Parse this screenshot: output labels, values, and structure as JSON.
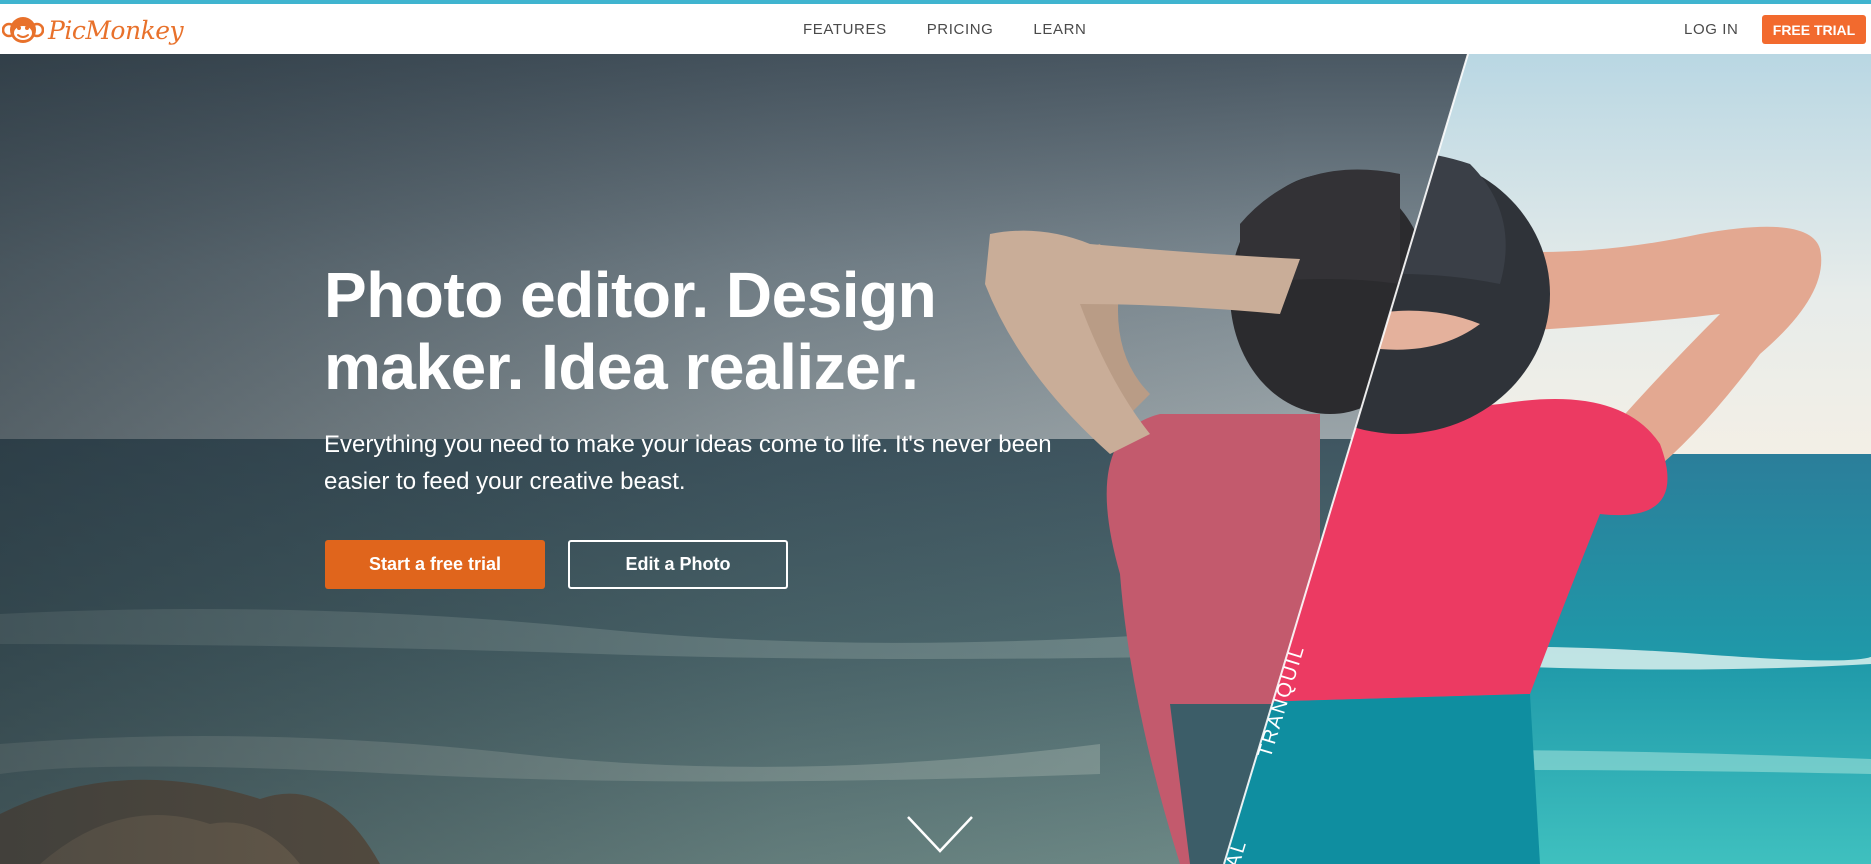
{
  "brand": {
    "name": "PicMonkey",
    "accent": "#f26a2e",
    "topline_color": "#3fb4cf"
  },
  "nav": {
    "links": [
      {
        "label": "FEATURES"
      },
      {
        "label": "PRICING"
      },
      {
        "label": "LEARN"
      }
    ],
    "login_label": "LOG IN",
    "cta_label": "FREE TRIAL"
  },
  "hero": {
    "headline": "Photo editor. Design maker. Idea realizer.",
    "subtext": "Everything you need to make your ideas come to life. It's never been easier to feed your creative beast.",
    "primary_button": "Start a free trial",
    "secondary_button": "Edit a Photo",
    "image_labels": [
      "TRANQUIL",
      "AL"
    ],
    "scroll_icon": "chevron-down-icon"
  }
}
